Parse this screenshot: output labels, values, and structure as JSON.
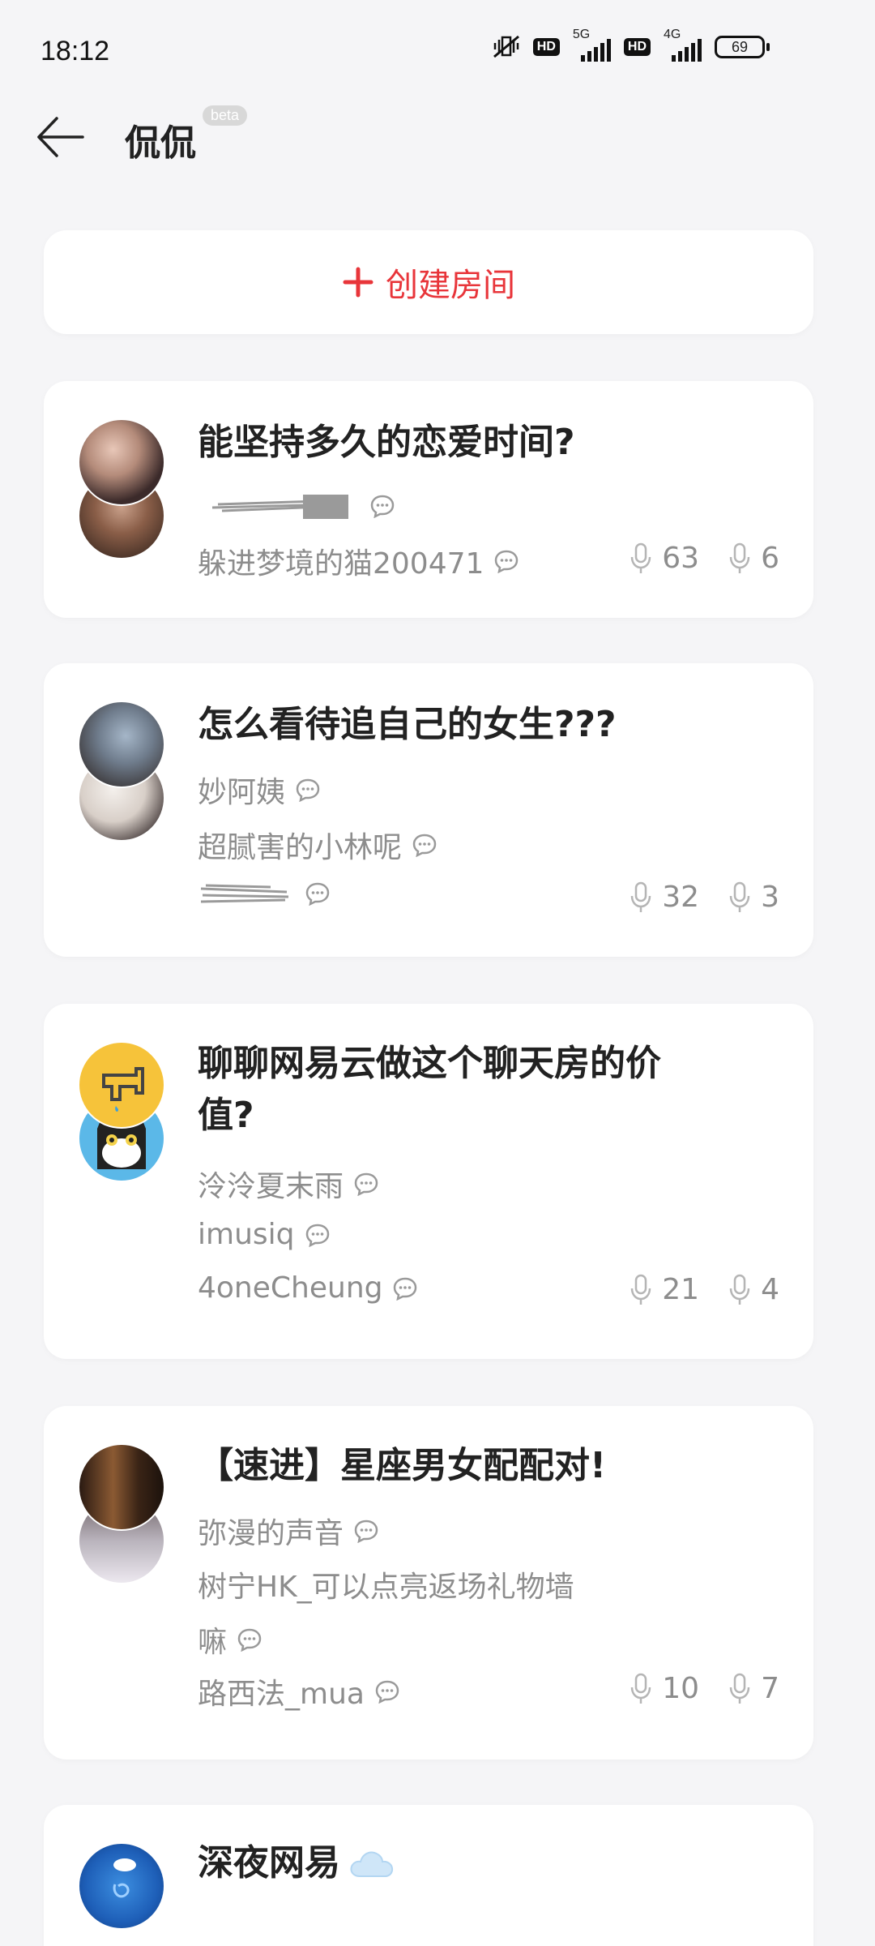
{
  "status_bar": {
    "time": "18:12",
    "net1": "5G",
    "net2": "4G",
    "battery": "69",
    "hd": "HD"
  },
  "header": {
    "title": "侃侃",
    "badge": "beta"
  },
  "create_room": {
    "label": "创建房间"
  },
  "rooms": [
    {
      "title": "能坚持多久的恋爱时间?",
      "members": [
        "",
        "躲进梦境的猫200471"
      ],
      "speakers": "63",
      "listeners": "6"
    },
    {
      "title": "怎么看待追自己的女生???",
      "members": [
        "妙阿姨",
        "超腻害的小林呢",
        ""
      ],
      "speakers": "32",
      "listeners": "3"
    },
    {
      "title_line1": "聊聊网易云做这个聊天房的价",
      "title_line2": "值?",
      "members": [
        "泠泠夏末雨",
        "imusiq",
        "4oneCheung"
      ],
      "speakers": "21",
      "listeners": "4"
    },
    {
      "title": "【速进】星座男女配配对!",
      "members": [
        "弥漫的声音",
        "树宁HK_可以点亮返场礼物墙",
        "嘛",
        "路西法_mua"
      ],
      "speakers": "10",
      "listeners": "7"
    },
    {
      "title": "深夜网易"
    }
  ],
  "colors": {
    "accent": "#e8353a",
    "background": "#f5f5f7",
    "card": "#ffffff",
    "muted_text": "#8d8d8d"
  },
  "icons": [
    "back-arrow-icon",
    "plus-icon",
    "chat-bubble-icon",
    "microphone-icon",
    "cloud-icon"
  ]
}
